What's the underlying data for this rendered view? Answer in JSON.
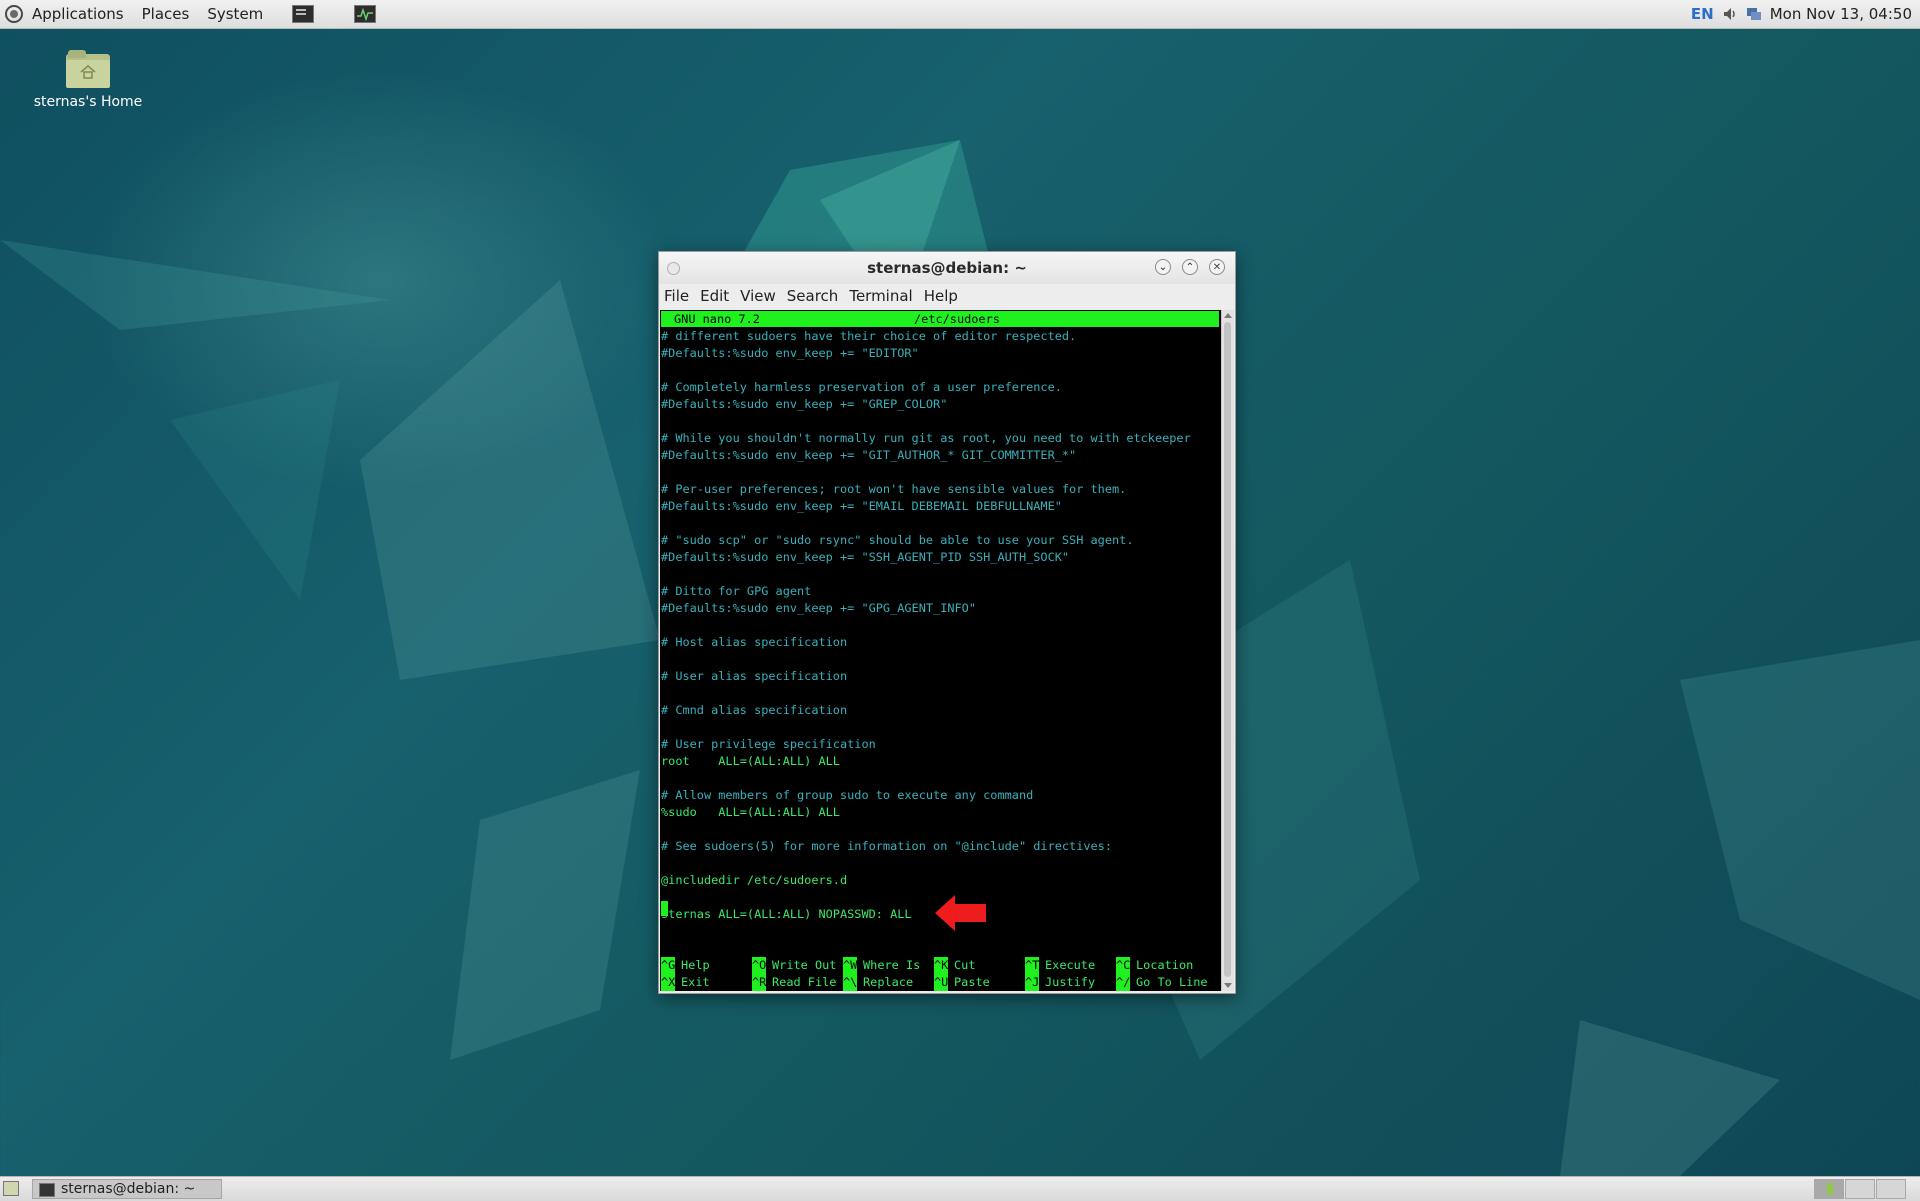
{
  "top_panel": {
    "menus": [
      "Applications",
      "Places",
      "System"
    ],
    "tray_lang": "EN",
    "clock": "Mon Nov 13, 04:50"
  },
  "desktop": {
    "home_icon_label": "sternas's Home"
  },
  "window": {
    "title": "sternas@debian: ~",
    "menu": [
      "File",
      "Edit",
      "View",
      "Search",
      "Terminal",
      "Help"
    ]
  },
  "nano": {
    "header_left": "GNU nano 7.2",
    "header_file": "/etc/sudoers",
    "lines": [
      "# different sudoers have their choice of editor respected.",
      "#Defaults:%sudo env_keep += \"EDITOR\"",
      "",
      "# Completely harmless preservation of a user preference.",
      "#Defaults:%sudo env_keep += \"GREP_COLOR\"",
      "",
      "# While you shouldn't normally run git as root, you need to with etckeeper",
      "#Defaults:%sudo env_keep += \"GIT_AUTHOR_* GIT_COMMITTER_*\"",
      "",
      "# Per-user preferences; root won't have sensible values for them.",
      "#Defaults:%sudo env_keep += \"EMAIL DEBEMAIL DEBFULLNAME\"",
      "",
      "# \"sudo scp\" or \"sudo rsync\" should be able to use your SSH agent.",
      "#Defaults:%sudo env_keep += \"SSH_AGENT_PID SSH_AUTH_SOCK\"",
      "",
      "# Ditto for GPG agent",
      "#Defaults:%sudo env_keep += \"GPG_AGENT_INFO\"",
      "",
      "# Host alias specification",
      "",
      "# User alias specification",
      "",
      "# Cmnd alias specification",
      "",
      "# User privilege specification",
      "root    ALL=(ALL:ALL) ALL",
      "",
      "# Allow members of group sudo to execute any command",
      "%sudo   ALL=(ALL:ALL) ALL",
      "",
      "# See sudoers(5) for more information on \"@include\" directives:",
      "",
      "@includedir /etc/sudoers.d",
      "",
      "sternas ALL=(ALL:ALL) NOPASSWD: ALL"
    ],
    "shortcuts_row1": [
      {
        "key": "^G",
        "label": "Help"
      },
      {
        "key": "^O",
        "label": "Write Out"
      },
      {
        "key": "^W",
        "label": "Where Is"
      },
      {
        "key": "^K",
        "label": "Cut"
      },
      {
        "key": "^T",
        "label": "Execute"
      },
      {
        "key": "^C",
        "label": "Location"
      }
    ],
    "shortcuts_row2": [
      {
        "key": "^X",
        "label": "Exit"
      },
      {
        "key": "^R",
        "label": "Read File"
      },
      {
        "key": "^\\",
        "label": "Replace"
      },
      {
        "key": "^U",
        "label": "Paste"
      },
      {
        "key": "^J",
        "label": "Justify"
      },
      {
        "key": "^/",
        "label": "Go To Line"
      }
    ]
  },
  "taskbar": {
    "window_button": "sternas@debian: ~"
  },
  "colors": {
    "nano_green": "#1ef11e",
    "comment_cyan": "#3ab0bb",
    "code_green": "#3ce86a",
    "arrow_red": "#ee1c1c"
  }
}
